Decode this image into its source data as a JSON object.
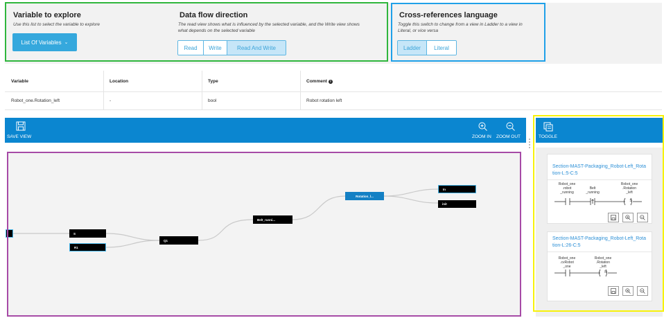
{
  "variable_panel": {
    "title": "Variable to explore",
    "description": "Use this list to select the variable to explore",
    "button_label": "List Of Variables",
    "button_chevron": "⌄"
  },
  "flow_panel": {
    "title": "Data flow direction",
    "description_line1": "The read view shows what is influenced by the selected variable, and the Write view shows",
    "description_line2": "what depends on the selected variable",
    "options": [
      "Read",
      "Write",
      "Read And Write"
    ],
    "selected": "Read And Write"
  },
  "language_panel": {
    "title": "Cross-references language",
    "description_line1": "Toggle this switch to change from a view in Ladder to a view in",
    "description_line2": "Literal, or vice versa",
    "options": [
      "Ladder",
      "Literal"
    ],
    "selected": "Ladder"
  },
  "table": {
    "headers": [
      "Variable",
      "Location",
      "Type",
      "Comment"
    ],
    "info_icon": "info-icon",
    "row": [
      "Robot_one.Rotation_left",
      "-",
      "bool",
      "Robot rotation left"
    ]
  },
  "toolbar": {
    "save_label": "SAVE VIEW",
    "zoom_in_label": "ZOOM IN",
    "zoom_out_label": "ZOOM OUT",
    "toggle_label": "TOGGLE"
  },
  "graph": {
    "nodes": {
      "s": "S",
      "r1": "R1",
      "q1": "Q1",
      "belt": "Belt_runni...",
      "rotation": "Rotation_l...",
      "in": "In",
      "init": "init"
    }
  },
  "cards": [
    {
      "title_line1": "Section-MAST-Packaging_Robot-Left_Rota",
      "title_line2": "tion-L:5-C:5",
      "contact1_line1": "Robot_one",
      "contact1_line2": ".robot",
      "contact1_line3": "_running",
      "contact2_line1": "Belt",
      "contact2_line2": "_running",
      "coil_line1": "Robot_one",
      "coil_line2": ".Rotation",
      "coil_line3": "_left",
      "coil_symbol": "S"
    },
    {
      "title_line1": "Section-MAST-Packaging_Robot-Left_Rota",
      "title_line2": "tion-L:26-C:5",
      "contact1_line1": "Robot_one",
      "contact1_line2": ".cvRobot",
      "contact1_line3": "_one",
      "coil_line1": "Robot_one",
      "coil_line2": ".Rotation",
      "coil_line3": "_left",
      "coil_symbol": "R"
    }
  ],
  "colors": {
    "accent": "#0b86d0",
    "button": "#35a8dd",
    "outline_green": "#2fb63d",
    "outline_blue": "#1fa0e8",
    "outline_yellow": "#f7f20a",
    "outline_purple": "#a64aa6"
  }
}
